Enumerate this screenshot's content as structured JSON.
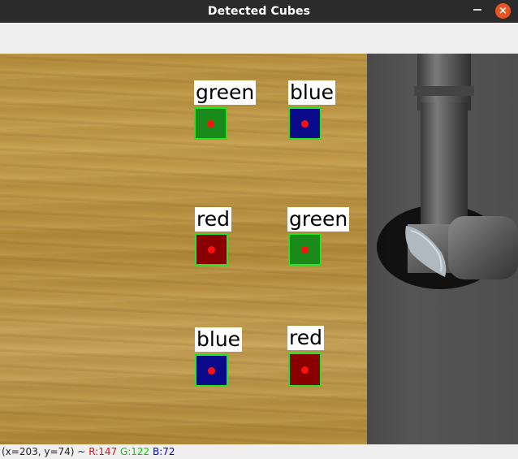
{
  "window": {
    "title": "Detected Cubes",
    "close_glyph": "×"
  },
  "status": {
    "coords": "(x=203, y=74) ~",
    "r": "R:147",
    "g": "G:122",
    "b": "B:72"
  },
  "colors": {
    "green_cube": "#1a8a1a",
    "blue_cube": "#0a0a8a",
    "red_cube": "#8a0000",
    "bbox": "#22e622",
    "centroid": "#ff1010"
  },
  "detections": [
    {
      "label": "green",
      "color": "#1a8a1a"
    },
    {
      "label": "blue",
      "color": "#0a0a8a"
    },
    {
      "label": "red",
      "color": "#8a0000"
    },
    {
      "label": "green",
      "color": "#1a8a1a"
    },
    {
      "label": "blue",
      "color": "#0a0a8a"
    },
    {
      "label": "red",
      "color": "#8a0000"
    }
  ]
}
